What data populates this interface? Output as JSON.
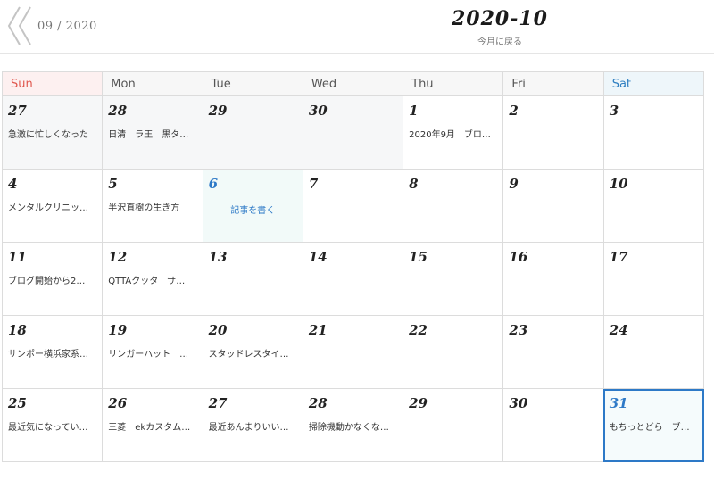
{
  "header": {
    "prev_month_label": "09 / 2020",
    "month_title": "2020-10",
    "back_link": "今月に戻る"
  },
  "weekdays": [
    "Sun",
    "Mon",
    "Tue",
    "Wed",
    "Thu",
    "Fri",
    "Sat"
  ],
  "weeks": [
    [
      {
        "day": "27",
        "entry": "急激に忙しくなった"
      },
      {
        "day": "28",
        "entry": "日清　ラ王　黒タ…"
      },
      {
        "day": "29",
        "entry": ""
      },
      {
        "day": "30",
        "entry": ""
      },
      {
        "day": "1",
        "entry": "2020年9月　ブロ…"
      },
      {
        "day": "2",
        "entry": ""
      },
      {
        "day": "3",
        "entry": ""
      }
    ],
    [
      {
        "day": "4",
        "entry": "メンタルクリニッ…"
      },
      {
        "day": "5",
        "entry": "半沢直樹の生き方"
      },
      {
        "day": "6",
        "entry": "",
        "write_link": "記事を書く"
      },
      {
        "day": "7",
        "entry": ""
      },
      {
        "day": "8",
        "entry": ""
      },
      {
        "day": "9",
        "entry": ""
      },
      {
        "day": "10",
        "entry": ""
      }
    ],
    [
      {
        "day": "11",
        "entry": "ブログ開始から2…"
      },
      {
        "day": "12",
        "entry": "QTTAクッタ　サ…"
      },
      {
        "day": "13",
        "entry": ""
      },
      {
        "day": "14",
        "entry": ""
      },
      {
        "day": "15",
        "entry": ""
      },
      {
        "day": "16",
        "entry": ""
      },
      {
        "day": "17",
        "entry": ""
      }
    ],
    [
      {
        "day": "18",
        "entry": "サンポー横浜家系…"
      },
      {
        "day": "19",
        "entry": "リンガーハット　…"
      },
      {
        "day": "20",
        "entry": "スタッドレスタイ…"
      },
      {
        "day": "21",
        "entry": ""
      },
      {
        "day": "22",
        "entry": ""
      },
      {
        "day": "23",
        "entry": ""
      },
      {
        "day": "24",
        "entry": ""
      }
    ],
    [
      {
        "day": "25",
        "entry": "最近気になってい…"
      },
      {
        "day": "26",
        "entry": "三菱　ekカスタム…"
      },
      {
        "day": "27",
        "entry": "最近あんまりいい…"
      },
      {
        "day": "28",
        "entry": "掃除機動かなくな…"
      },
      {
        "day": "29",
        "entry": ""
      },
      {
        "day": "30",
        "entry": ""
      },
      {
        "day": "31",
        "entry": "もちっとどら　ブ…"
      }
    ]
  ],
  "colors": {
    "sunday": "#e0584f",
    "saturday": "#2f7fc1",
    "accent": "#2d79c7"
  },
  "icons": {
    "prev_month": "double-chevron-left-icon"
  }
}
